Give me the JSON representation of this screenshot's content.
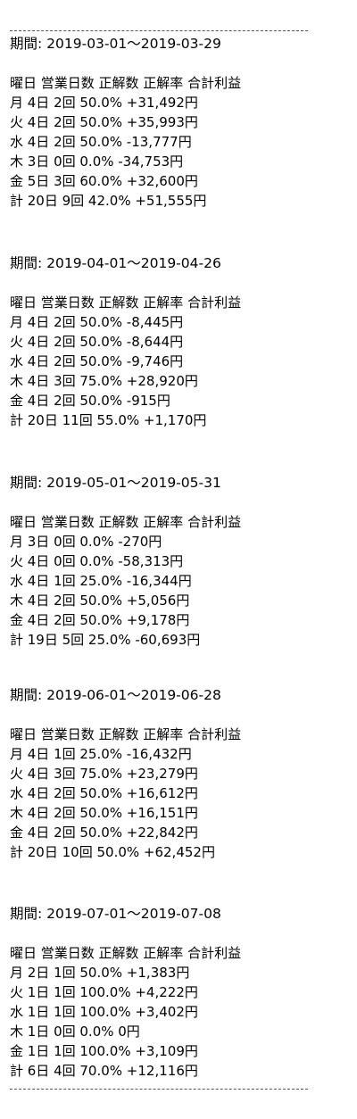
{
  "separator": "------------------------------------------------",
  "headers": [
    "曜日",
    "営業日数",
    "正解数",
    "正解率",
    "合計利益"
  ],
  "periods": [
    {
      "label": "期間: 2019-03-01〜2019-03-29",
      "rows": [
        "月 4日 2回 50.0% +31,492円",
        "火 4日 2回 50.0% +35,993円",
        "水 4日 2回 50.0% -13,777円",
        "木 3日 0回 0.0% -34,753円",
        "金 5日 3回 60.0% +32,600円",
        "計 20日 9回 42.0% +51,555円"
      ]
    },
    {
      "label": "期間: 2019-04-01〜2019-04-26",
      "rows": [
        "月 4日 2回 50.0% -8,445円",
        "火 4日 2回 50.0% -8,644円",
        "水 4日 2回 50.0% -9,746円",
        "木 4日 3回 75.0% +28,920円",
        "金 4日 2回 50.0% -915円",
        "計 20日 11回 55.0% +1,170円"
      ]
    },
    {
      "label": "期間: 2019-05-01〜2019-05-31",
      "rows": [
        "月 3日 0回 0.0% -270円",
        "火 4日 0回 0.0% -58,313円",
        "水 4日 1回 25.0% -16,344円",
        "木 4日 2回 50.0% +5,056円",
        "金 4日 2回 50.0% +9,178円",
        "計 19日 5回 25.0% -60,693円"
      ]
    },
    {
      "label": "期間: 2019-06-01〜2019-06-28",
      "rows": [
        "月 4日 1回 25.0% -16,432円",
        "火 4日 3回 75.0% +23,279円",
        "水 4日 2回 50.0% +16,612円",
        "木 4日 2回 50.0% +16,151円",
        "金 4日 2回 50.0% +22,842円",
        "計 20日 10回 50.0% +62,452円"
      ]
    },
    {
      "label": "期間: 2019-07-01〜2019-07-08",
      "rows": [
        "月 2日 1回 50.0% +1,383円",
        "火 1日 1回 100.0% +4,222円",
        "水 1日 1回 100.0% +3,402円",
        "木 1日 0回 0.0% 0円",
        "金 1日 1回 100.0% +3,109円",
        "計 6日 4回 70.0% +12,116円"
      ]
    }
  ]
}
